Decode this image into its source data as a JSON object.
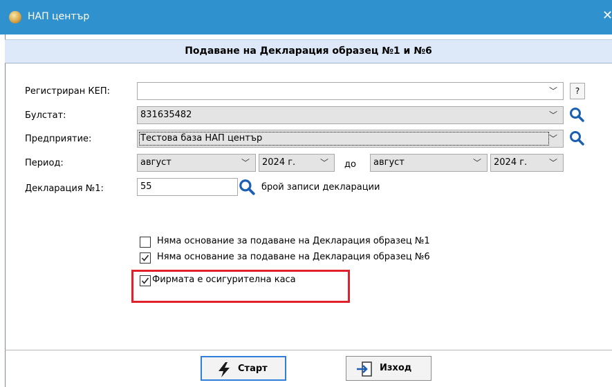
{
  "window": {
    "title": "НАП център",
    "close_glyph": "✕"
  },
  "header": {
    "title": "Подаване на Декларация образец №1 и №6"
  },
  "form": {
    "kep": {
      "label": "Регистриран КЕП:",
      "value": "",
      "help_label": "?"
    },
    "bulstat": {
      "label": "Булстат:",
      "value": "831635482"
    },
    "company": {
      "label": "Предприятие:",
      "value": "Тестова база НАП център"
    },
    "period": {
      "label": "Период:",
      "from_month": "август",
      "from_year": "2024 г.",
      "to_label": "до",
      "to_month": "август",
      "to_year": "2024 г."
    },
    "declaration1": {
      "label": "Декларация №1:",
      "value": "55",
      "records_label": "брой записи декларации"
    }
  },
  "checkboxes": [
    {
      "label": "Няма основание за подаване на Декларация образец №1",
      "checked": false
    },
    {
      "label": "Няма основание за подаване на Декларация образец №6",
      "checked": true
    },
    {
      "label": "Фирмата е осигурителна каса",
      "checked": true
    }
  ],
  "buttons": {
    "start_label": "Старт",
    "exit_label": "Изход"
  },
  "colors": {
    "titlebar": "#2f92cf",
    "header_bg": "#dde9f8",
    "highlight": "#e0202a",
    "accent": "#2f7ed8"
  }
}
